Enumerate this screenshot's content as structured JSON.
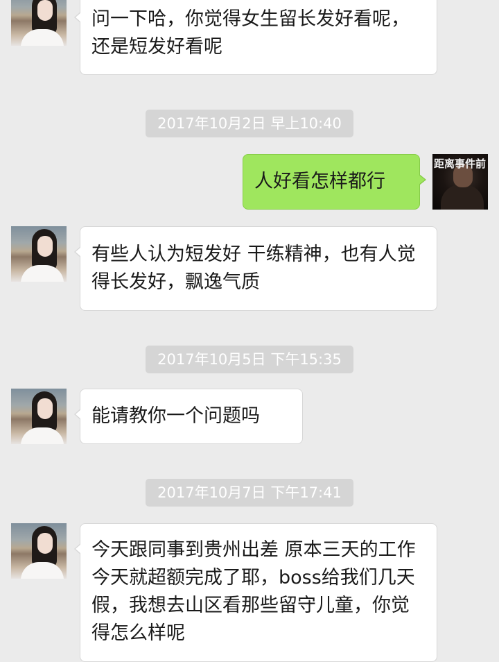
{
  "messages": [
    {
      "sender": "other",
      "text": "问一下哈，你觉得女生留长发好看呢，还是短发好看呢"
    },
    {
      "timestamp": "2017年10月2日 早上10:40"
    },
    {
      "sender": "self",
      "text": "人好看怎样都行"
    },
    {
      "sender": "other",
      "text": "有些人认为短发好 干练精神，也有人觉得长发好，飘逸气质"
    },
    {
      "timestamp": "2017年10月5日 下午15:35"
    },
    {
      "sender": "other",
      "text": "能请教你一个问题吗"
    },
    {
      "timestamp": "2017年10月7日 下午17:41"
    },
    {
      "sender": "other",
      "text": "今天跟同事到贵州出差 原本三天的工作今天就超额完成了耶，boss给我们几天假，我想去山区看那些留守儿童，你觉得怎么样呢"
    }
  ],
  "self_avatar_text": "距离事件前",
  "colors": {
    "background": "#ebebeb",
    "bubble_other": "#ffffff",
    "bubble_self": "#9fe65e",
    "timestamp_bg": "#d5d5d5",
    "timestamp_text": "#ffffff"
  }
}
